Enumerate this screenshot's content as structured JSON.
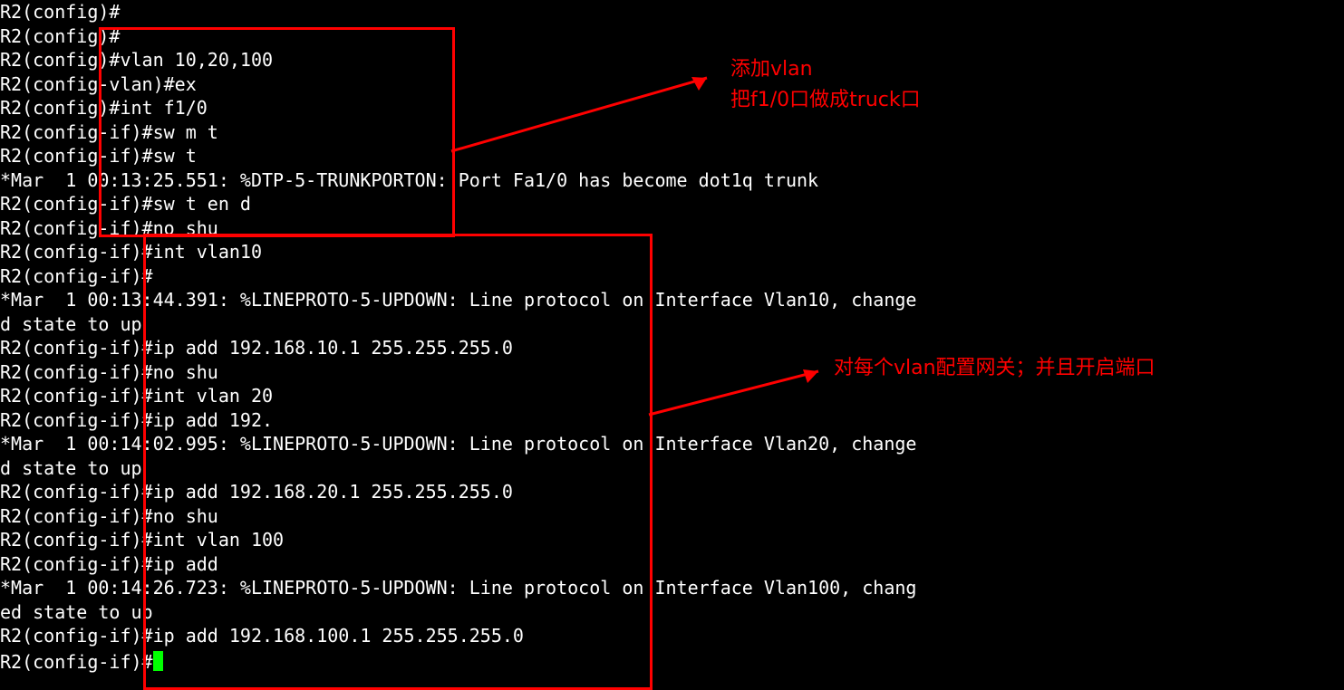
{
  "lines": [
    "R2(config)#",
    "R2(config)#",
    "R2(config)#vlan 10,20,100",
    "R2(config-vlan)#ex",
    "R2(config)#int f1/0",
    "R2(config-if)#sw m t",
    "R2(config-if)#sw t",
    "*Mar  1 00:13:25.551: %DTP-5-TRUNKPORTON: Port Fa1/0 has become dot1q trunk",
    "R2(config-if)#sw t en d",
    "R2(config-if)#no shu",
    "R2(config-if)#int vlan10",
    "R2(config-if)#",
    "*Mar  1 00:13:44.391: %LINEPROTO-5-UPDOWN: Line protocol on Interface Vlan10, change",
    "d state to up",
    "R2(config-if)#ip add 192.168.10.1 255.255.255.0",
    "R2(config-if)#no shu",
    "R2(config-if)#int vlan 20",
    "R2(config-if)#ip add 192.",
    "*Mar  1 00:14:02.995: %LINEPROTO-5-UPDOWN: Line protocol on Interface Vlan20, change",
    "d state to up",
    "R2(config-if)#ip add 192.168.20.1 255.255.255.0",
    "R2(config-if)#no shu",
    "R2(config-if)#int vlan 100",
    "R2(config-if)#ip add",
    "*Mar  1 00:14:26.723: %LINEPROTO-5-UPDOWN: Line protocol on Interface Vlan100, chang",
    "ed state to up",
    "R2(config-if)#ip add 192.168.100.1 255.255.255.0",
    "R2(config-if)#"
  ],
  "cursor_line": 27,
  "annot1_line1": "添加vlan",
  "annot1_line2": "把f1/0口做成truck口",
  "annot2": "对每个vlan配置网关；并且开启端口"
}
